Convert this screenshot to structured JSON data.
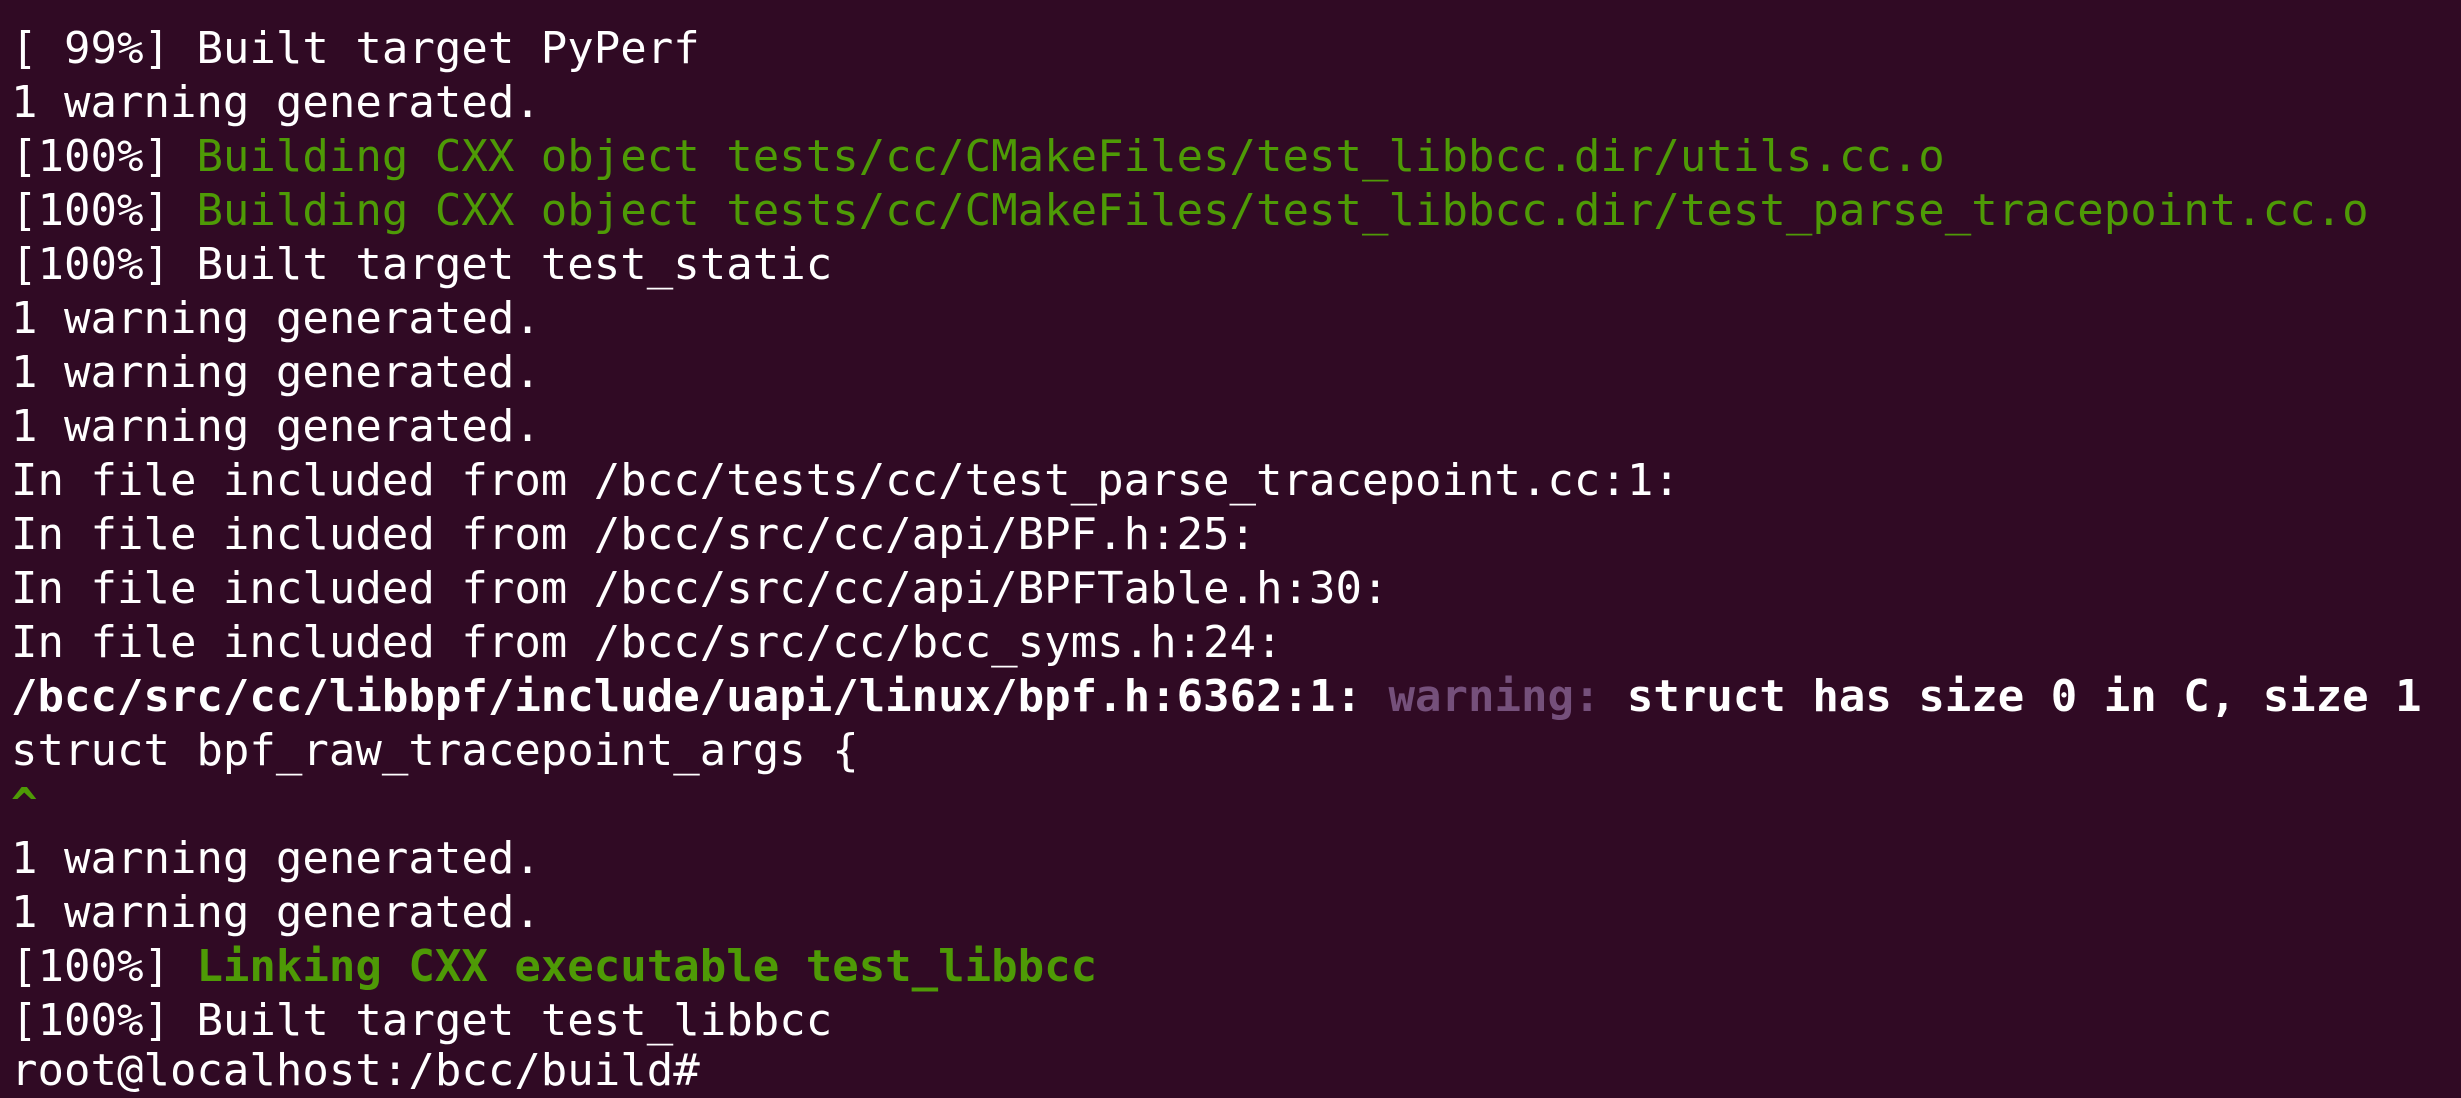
{
  "colors": {
    "background": "#300a24",
    "text": "#ffffff",
    "green": "#4e9a06",
    "warning": "#75507b"
  },
  "lines": [
    {
      "prefix": "[ 99%] ",
      "text": "Built target PyPerf"
    },
    {
      "text": "1 warning generated."
    },
    {
      "prefix": "[100%] ",
      "text": "Building CXX object tests/cc/CMakeFiles/test_libbcc.dir/utils.cc.o"
    },
    {
      "prefix": "[100%] ",
      "text": "Building CXX object tests/cc/CMakeFiles/test_libbcc.dir/test_parse_tracepoint.cc.o"
    },
    {
      "prefix": "[100%] ",
      "text": "Built target test_static"
    },
    {
      "text": "1 warning generated."
    },
    {
      "text": "1 warning generated."
    },
    {
      "text": "1 warning generated."
    },
    {
      "text": "In file included from /bcc/tests/cc/test_parse_tracepoint.cc:1:"
    },
    {
      "text": "In file included from /bcc/src/cc/api/BPF.h:25:"
    },
    {
      "text": "In file included from /bcc/src/cc/api/BPFTable.h:30:"
    },
    {
      "text": "In file included from /bcc/src/cc/bcc_syms.h:24:"
    },
    {
      "location": "/bcc/src/cc/libbpf/include/uapi/linux/bpf.h:6362:1: ",
      "label": "warning: ",
      "message": "struct has size 0 in C, size 1"
    },
    {
      "text": "struct bpf_raw_tracepoint_args {"
    },
    {
      "text": "^"
    },
    {
      "text": "1 warning generated."
    },
    {
      "text": "1 warning generated."
    },
    {
      "prefix": "[100%] ",
      "text": "Linking CXX executable test_libbcc"
    },
    {
      "prefix": "[100%] ",
      "text": "Built target test_libbcc"
    },
    {
      "text": "root@localhost:/bcc/build#"
    }
  ]
}
